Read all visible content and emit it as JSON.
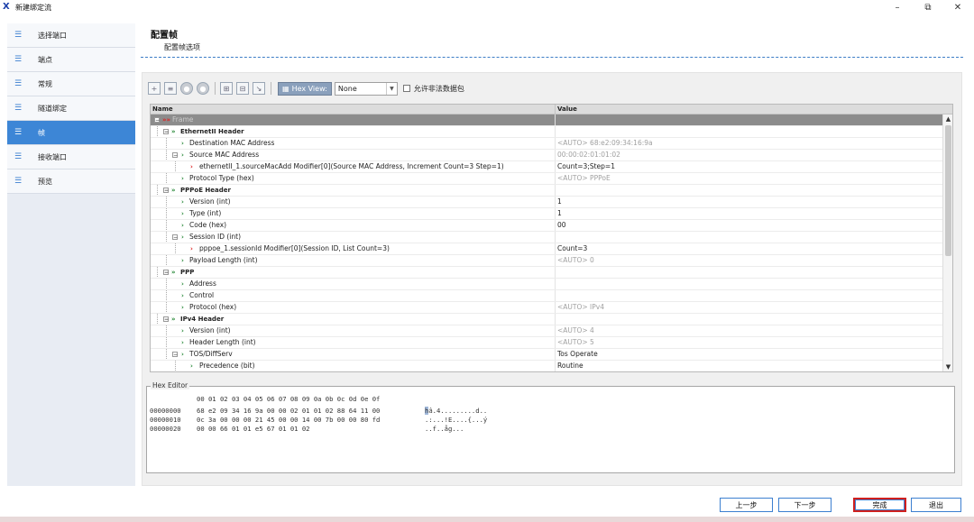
{
  "window": {
    "title": "新建绑定流",
    "controls": {
      "minimize": "–",
      "restore": "⧉",
      "close": "✕"
    }
  },
  "sidebar": {
    "items": [
      {
        "label": "选择端口",
        "active": false
      },
      {
        "label": "端点",
        "active": false
      },
      {
        "label": "常规",
        "active": false
      },
      {
        "label": "隧道绑定",
        "active": false
      },
      {
        "label": "帧",
        "active": true
      },
      {
        "label": "接收端口",
        "active": false
      },
      {
        "label": "预览",
        "active": false
      }
    ]
  },
  "header": {
    "title": "配置帧",
    "subtitle": "配置帧选项"
  },
  "toolbar": {
    "hex_view_label": "Hex View:",
    "hex_view_value": "None",
    "allow_invalid_label": "允许非法数据包",
    "allow_invalid_checked": false
  },
  "grid": {
    "columns": {
      "name": "Name",
      "value": "Value"
    },
    "rows": [
      {
        "name": "Frame",
        "value": "",
        "level": 0
      },
      {
        "name": "EthernetII Header",
        "value": "",
        "level": 1
      },
      {
        "name": "Destination MAC Address",
        "value": "<AUTO> 68:e2:09:34:16:9a",
        "level": 2
      },
      {
        "name": "Source MAC Address",
        "value": "00:00:02:01:01:02",
        "level": 2
      },
      {
        "name": "ethernetII_1.sourceMacAdd Modifier[0](Source MAC Address, Increment Count=3 Step=1)",
        "value": "Count=3;Step=1",
        "level": 3
      },
      {
        "name": "Protocol Type (hex)",
        "value": "<AUTO> PPPoE",
        "level": 2
      },
      {
        "name": "PPPoE Header",
        "value": "",
        "level": 1
      },
      {
        "name": "Version (int)",
        "value": "1",
        "level": 2
      },
      {
        "name": "Type (int)",
        "value": "1",
        "level": 2
      },
      {
        "name": "Code (hex)",
        "value": "00",
        "level": 2
      },
      {
        "name": "Session ID (int)",
        "value": "",
        "level": 2
      },
      {
        "name": "pppoe_1.sessionId Modifier[0](Session ID, List Count=3)",
        "value": "Count=3",
        "level": 3
      },
      {
        "name": "Payload Length (int)",
        "value": "<AUTO> 0",
        "level": 2
      },
      {
        "name": "PPP",
        "value": "",
        "level": 1
      },
      {
        "name": "Address",
        "value": "",
        "level": 2
      },
      {
        "name": "Control",
        "value": "",
        "level": 2
      },
      {
        "name": "Protocol (hex)",
        "value": "<AUTO> IPv4",
        "level": 2
      },
      {
        "name": "IPv4 Header",
        "value": "",
        "level": 1
      },
      {
        "name": "Version (int)",
        "value": "<AUTO> 4",
        "level": 2
      },
      {
        "name": "Header Length (int)",
        "value": "<AUTO> 5",
        "level": 2
      },
      {
        "name": "TOS/DiffServ",
        "value": "Tos Operate",
        "level": 2
      },
      {
        "name": "Precedence (bit)",
        "value": "Routine",
        "level": 3
      }
    ]
  },
  "hex_editor": {
    "title": "Hex Editor",
    "header": "00 01 02 03 04 05 06 07 08 09 0a 0b 0c 0d 0e 0f",
    "lines": [
      {
        "offset": "00000000",
        "bytes": "68 e2 09 34 16 9a 00 00 02 01 01 02 88 64 11 00",
        "ascii_first": "h",
        "ascii_rest": "â.4.........d.."
      },
      {
        "offset": "00000010",
        "bytes": "0c 3a 00 00 00 21 45 00 00 14 00 7b 00 00 80 fd",
        "ascii_first": "",
        "ascii_rest": ".:...!E....{...ý"
      },
      {
        "offset": "00000020",
        "bytes": "00 00 66 01 01 e5 67 01 01 02",
        "ascii_first": "",
        "ascii_rest": "..f..åg..."
      }
    ]
  },
  "buttons": {
    "prev": "上一步",
    "next": "下一步",
    "finish": "完成",
    "exit": "退出"
  }
}
